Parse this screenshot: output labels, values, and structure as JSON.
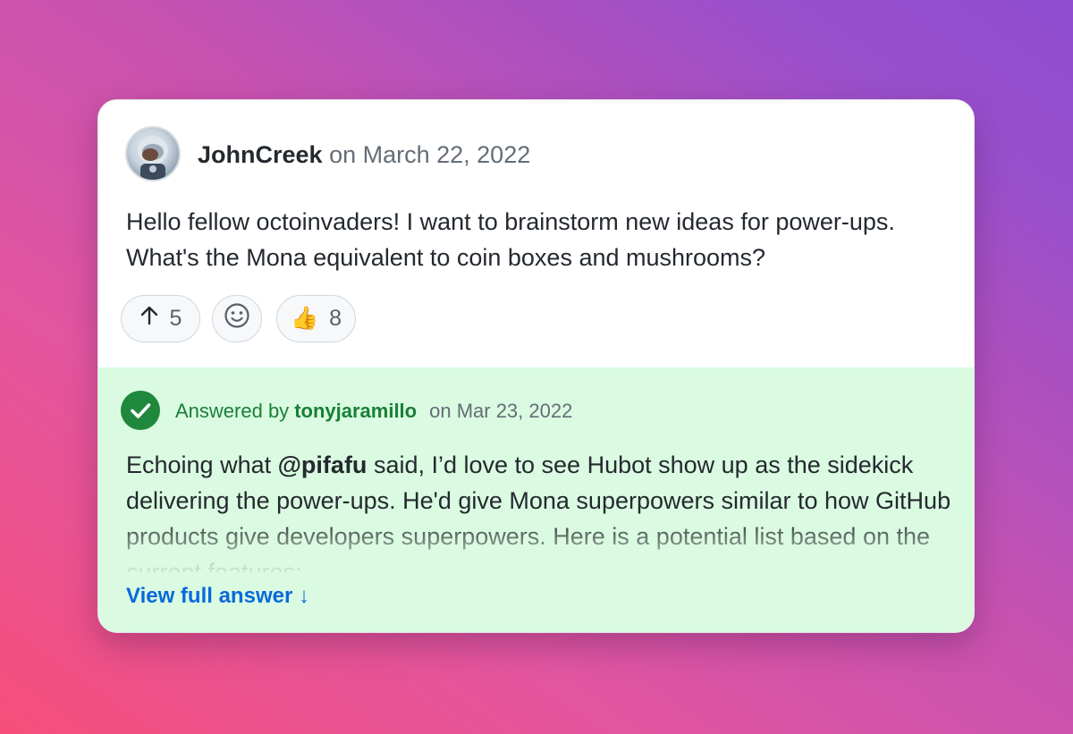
{
  "post": {
    "author": "JohnCreek",
    "date": "on March 22, 2022",
    "body": "Hello fellow octoinvaders! I want to brainstorm new ideas for power-ups. What's the Mona equivalent to coin boxes and mushrooms?",
    "reactions": {
      "upvote_count": "5",
      "thumbs_up_emoji": "👍",
      "thumbs_up_count": "8"
    }
  },
  "answer": {
    "answered_by_label": "Answered by",
    "user": "tonyjaramillo",
    "date": "on Mar 23, 2022",
    "text_before": "Echoing what ",
    "mention": "@pifafu",
    "text_after": " said, I’d love to see Hubot show up as the sidekick delivering the power-ups. He'd give Mona superpowers similar to how GitHub products give developers superpowers. Here is a potential list based on the current features:",
    "view_full_label": "View full answer ↓"
  },
  "icons": {
    "upvote": "arrow-up-icon",
    "add_reaction": "smiley-icon",
    "answered": "check-circle-icon"
  },
  "colors": {
    "answer_bg": "#dafbe1",
    "answer_green": "#1a7f37",
    "link_blue": "#0969da"
  }
}
